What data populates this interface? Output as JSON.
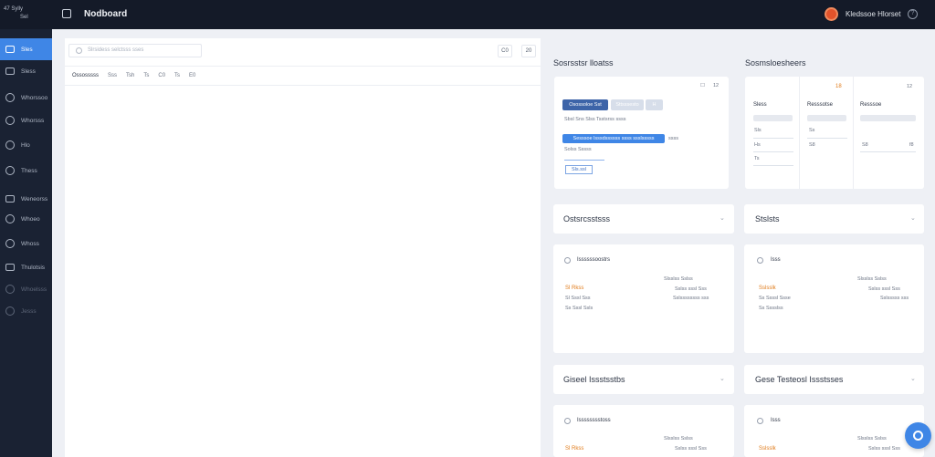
{
  "topbar": {
    "logo_line1": "47 Sylly",
    "logo_line2": "Sel",
    "title": "Nodboard",
    "user": "Kledssoe Hlorset",
    "help": "?"
  },
  "sidebar": {
    "items": [
      {
        "label": "Sles"
      },
      {
        "label": "Sless"
      },
      {
        "label": "Whorssoo"
      },
      {
        "label": "Whorsss"
      },
      {
        "label": "Hlo"
      },
      {
        "label": "Thess"
      },
      {
        "label": "Weneorss"
      },
      {
        "label": "Whoeo"
      },
      {
        "label": "Whoss"
      },
      {
        "label": "Thulotsis"
      },
      {
        "label": "Whoelsss"
      },
      {
        "label": "Jesss"
      }
    ]
  },
  "left_panel": {
    "search_placeholder": "Slrsidess selctsss sses",
    "btn1": "C0",
    "btn2": "20",
    "tabs": [
      "Ossosssss",
      "Sss",
      "Tsh",
      "Ts",
      "C0",
      "Ts",
      "E0"
    ]
  },
  "right": {
    "sec1_title": "Sosrsstsr lloatss",
    "sec2_title": "Sosmsloesheers",
    "card1": {
      "icon1": "☐",
      "icon2": "12",
      "btn_primary": "Osossoloe Sst",
      "btn_light": "Sttsssesto",
      "btn_small": "H",
      "row1": "Sbsl Sns Slss Tsstsrss ssss",
      "btn_blue": "Sesssoe lsssdssssss ssss ssslsssss",
      "btn_blue_side": "ssss",
      "row2": "Solss Sssss",
      "tag": "Sls.ssl"
    },
    "card2": {
      "col1_title": "Sless",
      "col2_title": "Resssotse",
      "col2_badge": "18",
      "col3_title": "Resssoe",
      "col3_badge": "12",
      "c1_r1": "Sls",
      "c1_r2": "Hs",
      "c1_r3": "Ts",
      "c2_r1": "Ss",
      "c2_r2": "S8",
      "c3_r1": "S8",
      "c3_r2": "f8"
    },
    "collapse1": "Ostsrcsstsss",
    "collapse2": "Stslsts",
    "collapse3": "Giseel Issstsstbs",
    "collapse4": "Gese Testeosl Issstsses",
    "chev": "⌄",
    "panel_a": {
      "title": "Issssssoostrs",
      "r1": "Sl Rkss",
      "r2": "Sl Sssl Sss",
      "r3": "Ss Sssl Ssls",
      "right1": "Slsslss Sslss",
      "right2": "Sslss sssl Sss",
      "right3": "Sslssssssss sss"
    },
    "panel_b": {
      "title": "Isss",
      "r1": "Sslsslk",
      "r2": "Ss Ssssl Ssse",
      "r3": "Ss Sssslss",
      "right1": "Slsslss Sslss",
      "right2": "Sslss sssl Sss",
      "right3": "Sslsssss sss"
    },
    "panel_c": {
      "title": "Isssssssstoss",
      "r1": "Sl Rkss",
      "right1": "Slsslss Sslss",
      "right2": "Sslss sssl Sss"
    },
    "panel_d": {
      "title": "Isss",
      "r1": "Sslsslk",
      "right1": "Slsslss Sslss",
      "right2": "Sslss sssl Sss"
    }
  }
}
